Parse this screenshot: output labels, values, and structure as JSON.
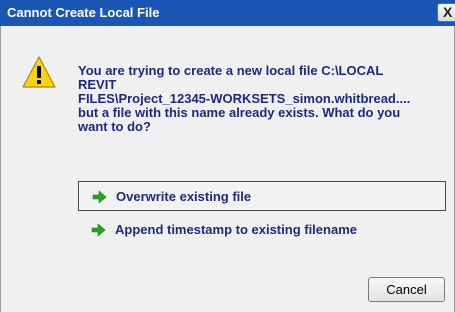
{
  "window": {
    "title": "Cannot Create Local File",
    "close_label": "X"
  },
  "message": {
    "lines": [
      "You are trying to create a new local file C:\\LOCAL",
      "REVIT",
      "FILES\\Project_12345-WORKSETS_simon.whitbread....",
      "but a file with this name already exists. What do you",
      "want to do?"
    ]
  },
  "options": [
    {
      "label": "Overwrite existing file",
      "selected": true,
      "icon": "green-arrow-icon"
    },
    {
      "label": "Append timestamp to existing filename",
      "selected": false,
      "icon": "green-arrow-icon"
    }
  ],
  "buttons": {
    "cancel_label": "Cancel"
  },
  "icons": {
    "warning": "warning-icon"
  },
  "colors": {
    "titlebar": "#1a56b3",
    "message_text": "#1e2a7a",
    "arrow": "#2aa32a",
    "warning_fill": "#f7d417"
  }
}
